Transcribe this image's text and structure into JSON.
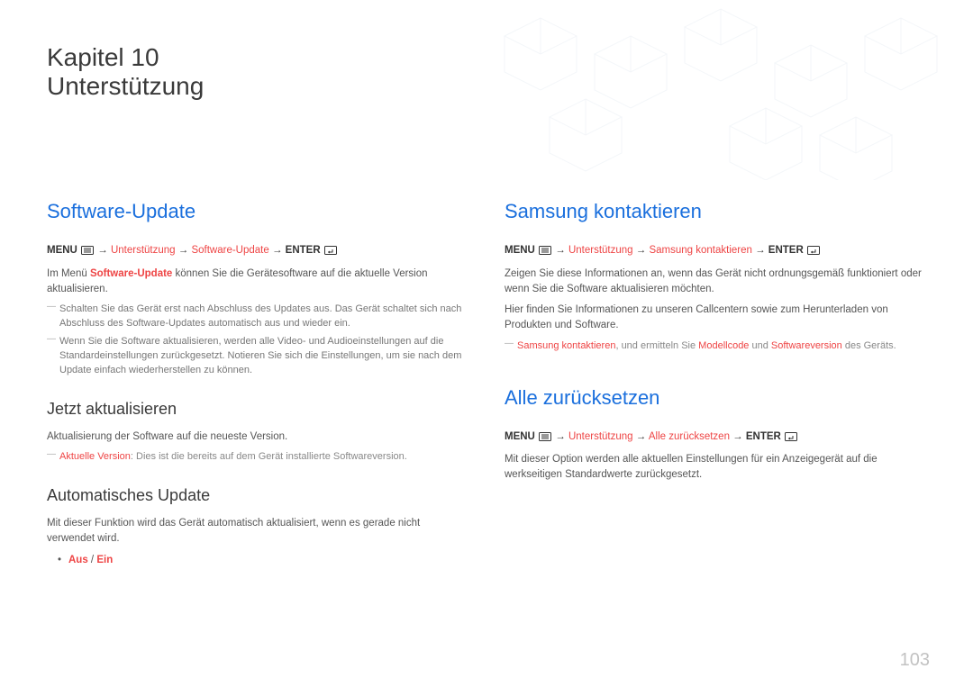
{
  "chapter": {
    "line": "Kapitel 10",
    "title": "Unterstützung"
  },
  "page_number": "103",
  "icons": {
    "menu": "menu-icon",
    "enter": "enter-icon"
  },
  "left": {
    "software_update": {
      "heading": "Software-Update",
      "path": {
        "menu": "MENU",
        "seg1": "Unterstützung",
        "seg2": "Software-Update",
        "enter": "ENTER"
      },
      "intro_pre": "Im Menü ",
      "intro_hl": "Software-Update",
      "intro_post": " können Sie die Gerätesoftware auf die aktuelle Version aktualisieren.",
      "note1": "Schalten Sie das Gerät erst nach Abschluss des Updates aus. Das Gerät schaltet sich nach Abschluss des Software-Updates automatisch aus und wieder ein.",
      "note2": "Wenn Sie die Software aktualisieren, werden alle Video- und Audioeinstellungen auf die Standardeinstellungen zurückgesetzt. Notieren Sie sich die Einstellungen, um sie nach dem Update einfach wiederherstellen zu können."
    },
    "update_now": {
      "heading": "Jetzt aktualisieren",
      "body": "Aktualisierung der Software auf die neueste Version.",
      "note_hl": "Aktuelle Version",
      "note_rest": ": Dies ist die bereits auf dem Gerät installierte Softwareversion."
    },
    "auto_update": {
      "heading": "Automatisches Update",
      "body": "Mit dieser Funktion wird das Gerät automatisch aktualisiert, wenn es gerade nicht verwendet wird.",
      "opt_aus": "Aus",
      "opt_sep": " / ",
      "opt_ein": "Ein"
    }
  },
  "right": {
    "contact": {
      "heading": "Samsung kontaktieren",
      "path": {
        "menu": "MENU",
        "seg1": "Unterstützung",
        "seg2": "Samsung kontaktieren",
        "enter": "ENTER"
      },
      "body1": "Zeigen Sie diese Informationen an, wenn das Gerät nicht ordnungsgemäß funktioniert oder wenn Sie die Software aktualisieren möchten.",
      "body2": "Hier finden Sie Informationen zu unseren Callcentern sowie zum Herunterladen von Produkten und Software.",
      "note_hl1": "Samsung kontaktieren",
      "note_mid1": ", und ermitteln Sie ",
      "note_hl2": "Modellcode",
      "note_mid2": " und ",
      "note_hl3": "Softwareversion",
      "note_end": " des Geräts."
    },
    "reset": {
      "heading": "Alle zurücksetzen",
      "path": {
        "menu": "MENU",
        "seg1": "Unterstützung",
        "seg2": "Alle zurücksetzen",
        "enter": "ENTER"
      },
      "body": "Mit dieser Option werden alle aktuellen Einstellungen für ein Anzeigegerät auf die werkseitigen Standardwerte zurückgesetzt."
    }
  }
}
